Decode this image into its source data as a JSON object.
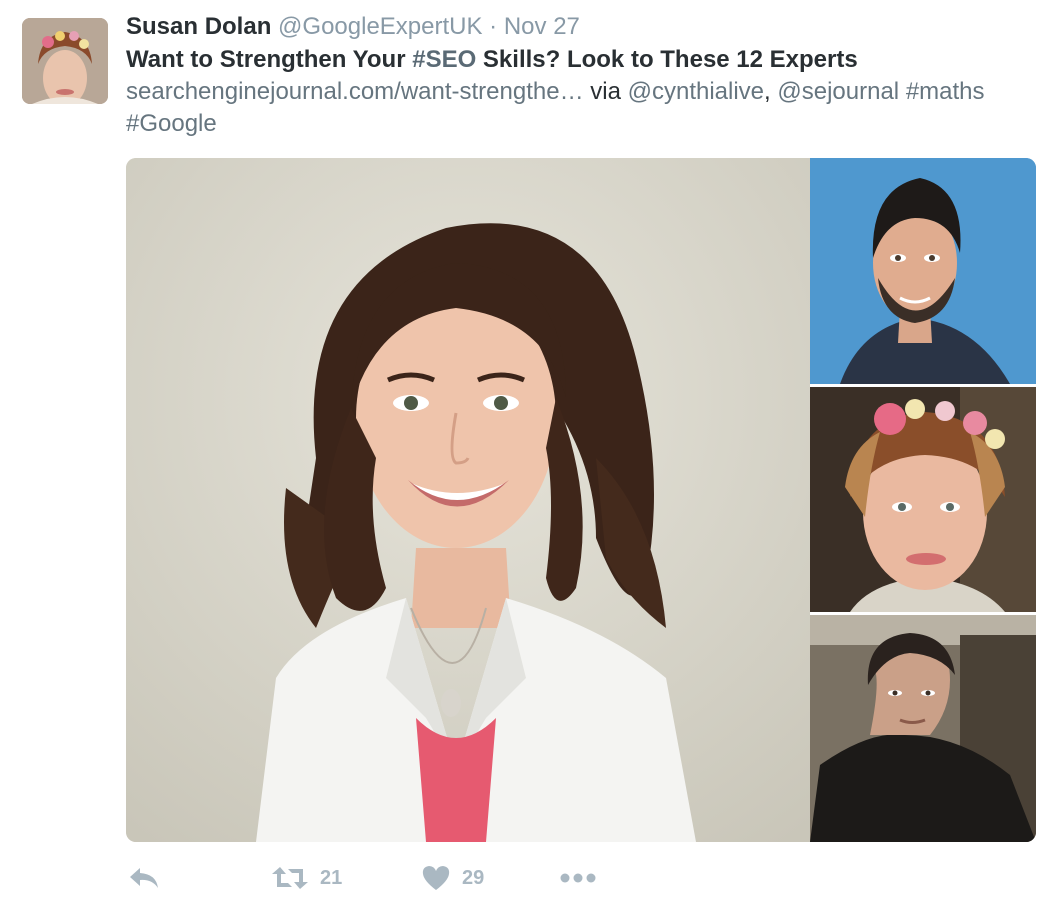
{
  "tweet": {
    "author_name": "Susan Dolan",
    "author_handle": "@GoogleExpertUK",
    "separator": "·",
    "timestamp": "Nov 27",
    "title_part1": "Want to Strengthen Your ",
    "title_hashtag": "#SEO",
    "title_part2": " Skills",
    "title_part3": "? Look to These 12 Experts",
    "link_text": "searchenginejournal.com/want-strengthe…",
    "via_text": " via ",
    "mention1": "@cynthialive",
    "comma": ", ",
    "mention2": "@sejournal",
    "space": " ",
    "hashtag1": "#maths",
    "hashtag2": "#Google"
  },
  "actions": {
    "retweet_count": "21",
    "like_count": "29"
  },
  "icons": {
    "reply": "reply-icon",
    "retweet": "retweet-icon",
    "like": "heart-icon",
    "more": "more-dots-icon"
  },
  "colors": {
    "text": "#292f33",
    "secondary": "#8899a6",
    "action": "#aab8c2"
  }
}
